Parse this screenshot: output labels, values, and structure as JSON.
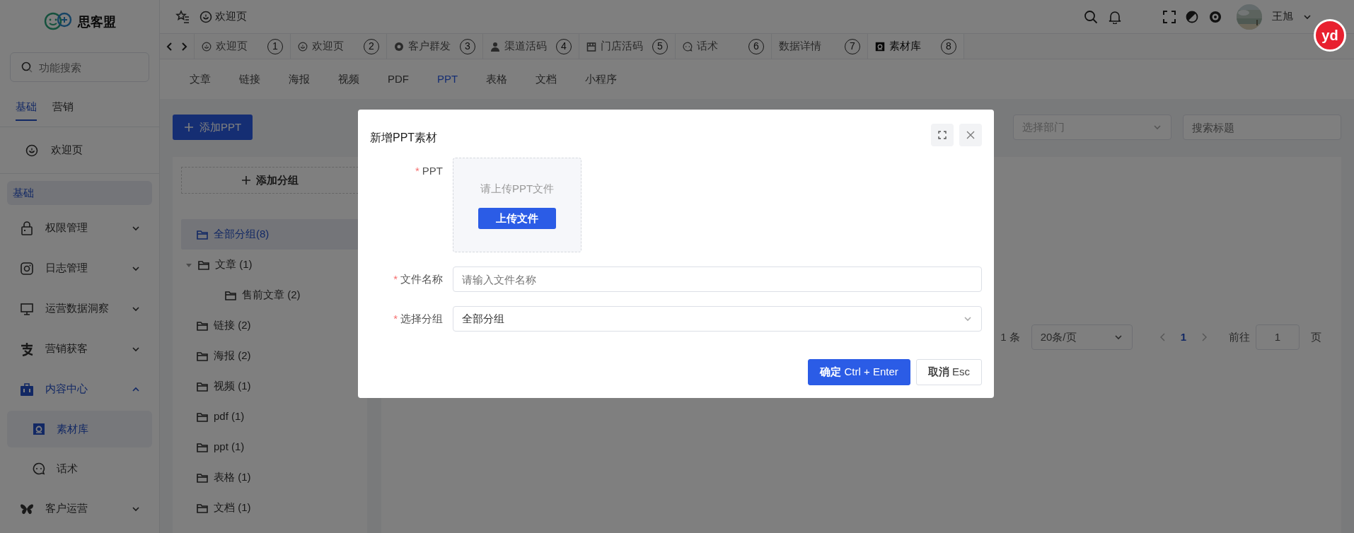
{
  "app": {
    "logo_text": "思客盟"
  },
  "sidebar": {
    "search": {
      "placeholder": "功能搜索"
    },
    "tabs": [
      {
        "label": "基础",
        "selected": true
      },
      {
        "label": "营销",
        "selected": false
      }
    ],
    "home": {
      "label": "欢迎页"
    },
    "section": "基础",
    "menu": [
      {
        "label": "权限管理",
        "expanded": false,
        "selected": false
      },
      {
        "label": "日志管理",
        "expanded": false,
        "selected": false
      },
      {
        "label": "运营数据洞察",
        "expanded": false,
        "selected": false
      },
      {
        "label": "营销获客",
        "expanded": false,
        "selected": false
      },
      {
        "label": "内容中心",
        "expanded": true,
        "selected": true,
        "children": [
          {
            "label": "素材库",
            "selected": true
          },
          {
            "label": "话术",
            "selected": false
          }
        ]
      },
      {
        "label": "客户运营",
        "expanded": false,
        "selected": false
      }
    ]
  },
  "top_bar": {
    "breadcrumb": "欢迎页",
    "user_name": "王旭"
  },
  "tabs": [
    {
      "label": "欢迎页",
      "number": "1",
      "selected": false
    },
    {
      "label": "欢迎页",
      "number": "2",
      "selected": false
    },
    {
      "label": "客户群发",
      "number": "3",
      "selected": false
    },
    {
      "label": "渠道活码",
      "number": "4",
      "selected": false
    },
    {
      "label": "门店活码",
      "number": "5",
      "selected": false
    },
    {
      "label": "话术",
      "number": "6",
      "selected": false
    },
    {
      "label": "数据详情",
      "number": "7",
      "selected": false
    },
    {
      "label": "素材库",
      "number": "8",
      "selected": true
    }
  ],
  "subtabs": [
    {
      "label": "文章",
      "selected": false
    },
    {
      "label": "链接",
      "selected": false
    },
    {
      "label": "海报",
      "selected": false
    },
    {
      "label": "视频",
      "selected": false
    },
    {
      "label": "PDF",
      "selected": false
    },
    {
      "label": "PPT",
      "selected": true
    },
    {
      "label": "表格",
      "selected": false
    },
    {
      "label": "文档",
      "selected": false
    },
    {
      "label": "小程序",
      "selected": false
    }
  ],
  "toolbar": {
    "add_button": "添加PPT",
    "department": {
      "placeholder": "选择部门"
    },
    "search": {
      "placeholder": "搜索标题"
    }
  },
  "groups": {
    "add_button": "添加分组",
    "tree": [
      {
        "label": "全部分组(8)",
        "selected": true
      },
      {
        "label": "文章 (1)",
        "selected": false,
        "expanded": true,
        "children": [
          {
            "label": "售前文章 (2)",
            "selected": false
          }
        ]
      },
      {
        "label": "链接 (2)",
        "selected": false
      },
      {
        "label": "海报 (2)",
        "selected": false
      },
      {
        "label": "视频 (1)",
        "selected": false
      },
      {
        "label": "pdf (1)",
        "selected": false
      },
      {
        "label": "ppt (1)",
        "selected": false
      },
      {
        "label": "表格 (1)",
        "selected": false
      },
      {
        "label": "文档 (1)",
        "selected": false
      }
    ]
  },
  "pagination": {
    "total": "1 条",
    "page_size": "20条/页",
    "pages": [
      {
        "label": "1",
        "selected": true
      }
    ],
    "goto_label": "前往",
    "goto_value": "1",
    "page_unit": "页"
  },
  "modal": {
    "title": "新增PPT素材",
    "fields": [
      {
        "kind": "upload",
        "label": "PPT",
        "required_mark": "*",
        "hint": "请上传PPT文件",
        "button": "上传文件"
      },
      {
        "kind": "input",
        "label": "文件名称",
        "required_mark": "*",
        "placeholder": "请输入文件名称"
      },
      {
        "kind": "select",
        "label": "选择分组",
        "required_mark": "*",
        "value": "全部分组"
      }
    ],
    "buttons": [
      {
        "label": "**确定** Ctrl + Enter",
        "kind": "primary"
      },
      {
        "label": "**取消** Esc",
        "kind": "default"
      }
    ]
  },
  "floating_badge": "yd"
}
